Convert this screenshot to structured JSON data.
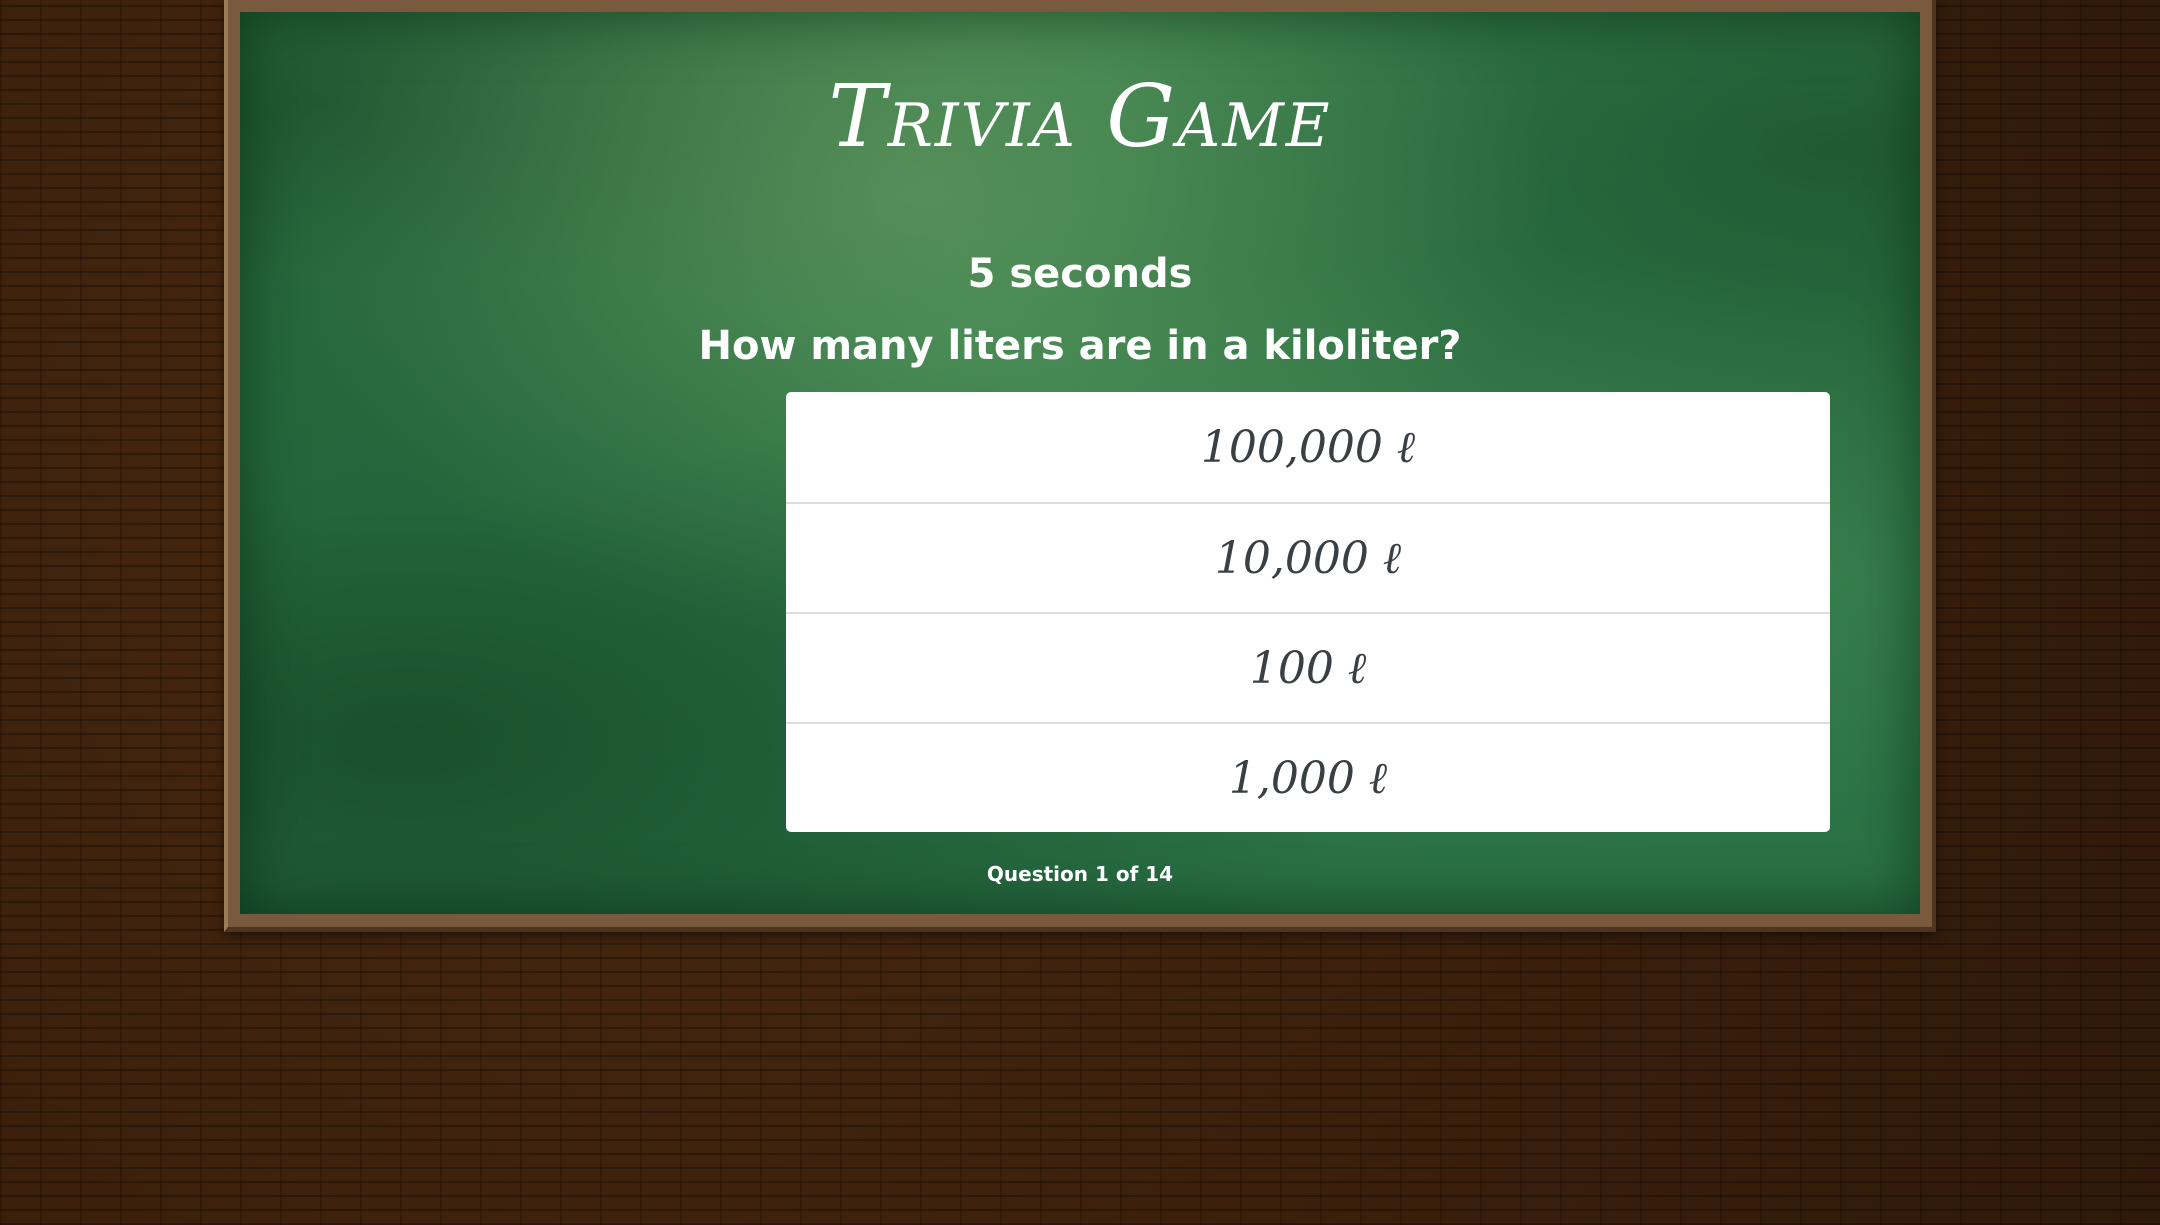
{
  "game": {
    "title": "Trivia Game",
    "timer": "5 seconds",
    "question": "How many liters are in a kiloliter?",
    "answers": [
      "100,000 ℓ",
      "10,000 ℓ",
      "100 ℓ",
      "1,000 ℓ"
    ],
    "progress": "Question 1 of 14"
  },
  "colors": {
    "board": "#2f7a4a",
    "frame": "#7a5a3c",
    "wall": "#3a1f0c",
    "answer_text": "#3a3f44"
  }
}
